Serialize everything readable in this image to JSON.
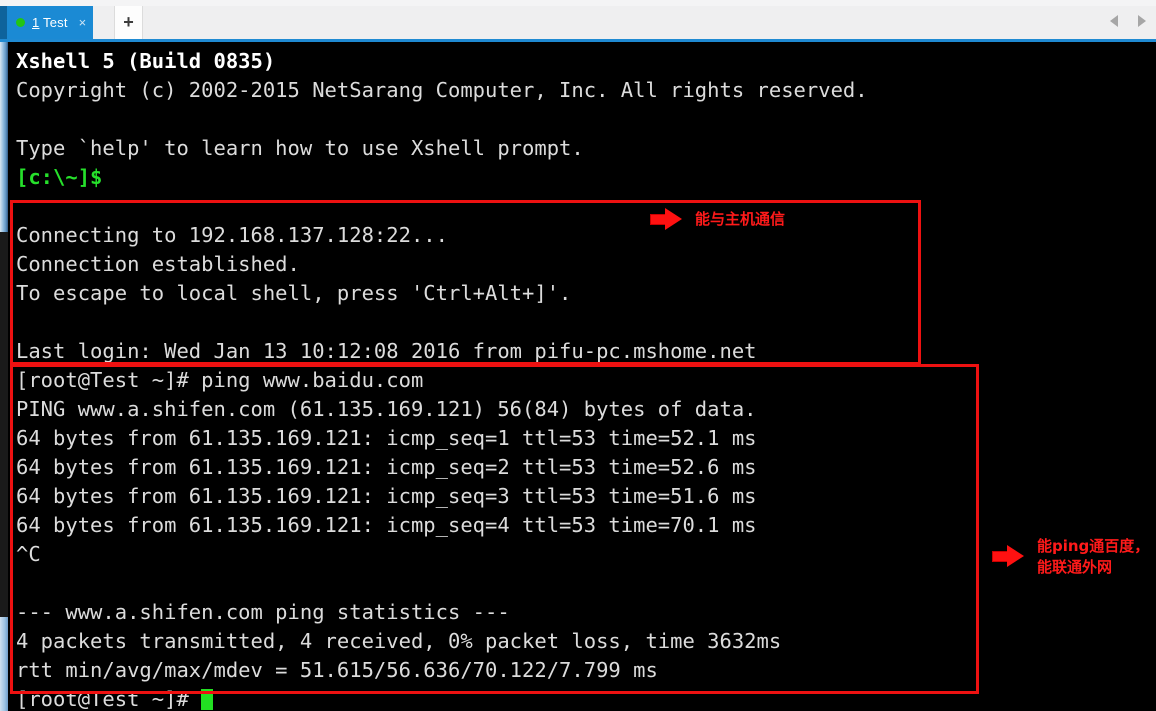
{
  "window": {
    "tab": {
      "index": "1",
      "title": " Test",
      "full_label": "1 Test",
      "close_label": "×",
      "status_color": "#22c516",
      "active_color": "#1b8ad4"
    },
    "new_tab_label": "+",
    "nav_prev": "prev-tab",
    "nav_next": "next-tab"
  },
  "terminal": {
    "background": "#000000",
    "foreground": "#dcdcdc",
    "prompt_color": "#26e02b",
    "cursor_color": "#22e022",
    "lines": [
      {
        "text": "Xshell 5 (Build 0835)",
        "style": "bright"
      },
      {
        "text": "Copyright (c) 2002-2015 NetSarang Computer, Inc. All rights reserved.",
        "style": "normal"
      },
      {
        "text": "",
        "style": "blank"
      },
      {
        "text": "Type `help' to learn how to use Xshell prompt.",
        "style": "normal"
      },
      {
        "text": "[c:\\~]$",
        "style": "green"
      },
      {
        "text": "",
        "style": "blank"
      },
      {
        "text": "Connecting to 192.168.137.128:22...",
        "style": "normal"
      },
      {
        "text": "Connection established.",
        "style": "normal"
      },
      {
        "text": "To escape to local shell, press 'Ctrl+Alt+]'.",
        "style": "normal"
      },
      {
        "text": "",
        "style": "blank"
      },
      {
        "text": "Last login: Wed Jan 13 10:12:08 2016 from pifu-pc.mshome.net",
        "style": "normal"
      },
      {
        "text": "[root@Test ~]# ping www.baidu.com",
        "style": "normal"
      },
      {
        "text": "PING www.a.shifen.com (61.135.169.121) 56(84) bytes of data.",
        "style": "normal"
      },
      {
        "text": "64 bytes from 61.135.169.121: icmp_seq=1 ttl=53 time=52.1 ms",
        "style": "normal"
      },
      {
        "text": "64 bytes from 61.135.169.121: icmp_seq=2 ttl=53 time=52.6 ms",
        "style": "normal"
      },
      {
        "text": "64 bytes from 61.135.169.121: icmp_seq=3 ttl=53 time=51.6 ms",
        "style": "normal"
      },
      {
        "text": "64 bytes from 61.135.169.121: icmp_seq=4 ttl=53 time=70.1 ms",
        "style": "normal"
      },
      {
        "text": "^C",
        "style": "normal"
      },
      {
        "text": "",
        "style": "blank"
      },
      {
        "text": "--- www.a.shifen.com ping statistics ---",
        "style": "normal"
      },
      {
        "text": "4 packets transmitted, 4 received, 0% packet loss, time 3632ms",
        "style": "normal"
      },
      {
        "text": "rtt min/avg/max/mdev = 51.615/56.636/70.122/7.799 ms",
        "style": "normal"
      },
      {
        "text": "[root@Test ~]# ",
        "style": "cursor"
      }
    ]
  },
  "annotations": {
    "color": "#ff1a1a",
    "host_note": "能与主机通信",
    "ping_note_line1": "能ping通百度，",
    "ping_note_line2": "能联通外网",
    "box_connect_label": "connection-highlight",
    "box_ping_label": "ping-output-highlight"
  }
}
